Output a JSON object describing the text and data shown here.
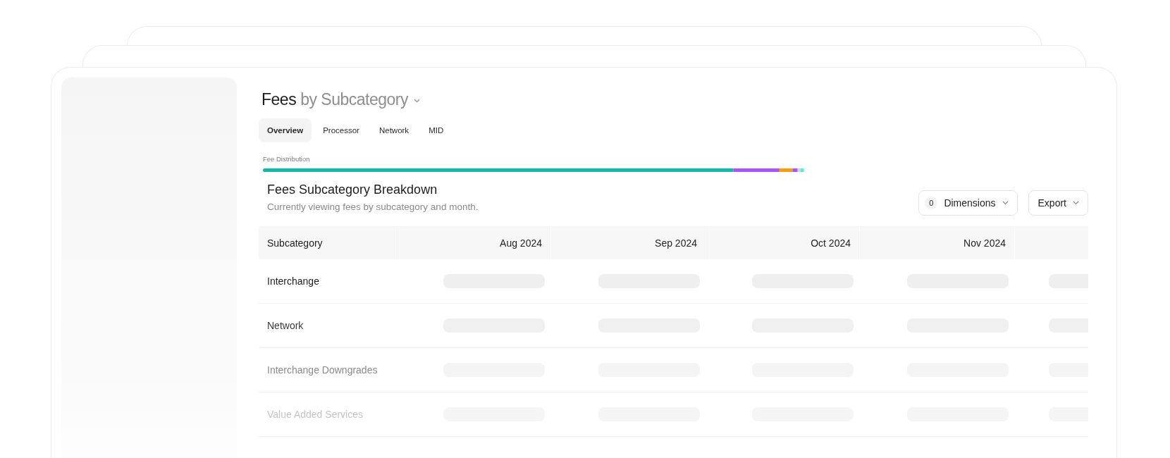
{
  "header": {
    "title": "Fees",
    "title_suffix": "by Subcategory"
  },
  "tabs": [
    {
      "label": "Overview",
      "selected": true
    },
    {
      "label": "Processor",
      "selected": false
    },
    {
      "label": "Network",
      "selected": false
    },
    {
      "label": "MID",
      "selected": false
    }
  ],
  "distribution": {
    "label": "Fee Distribution"
  },
  "section": {
    "title": "Fees Subcategory Breakdown",
    "subtitle": "Currently viewing fees by subcategory and month."
  },
  "buttons": {
    "dimensions_count": "0",
    "dimensions": "Dimensions",
    "export": "Export"
  },
  "table": {
    "columns": [
      "Subcategory",
      "Aug 2024",
      "Sep 2024",
      "Oct 2024",
      "Nov 2024"
    ],
    "rows": [
      {
        "name": "Interchange"
      },
      {
        "name": "Network"
      },
      {
        "name": "Interchange Downgrades"
      },
      {
        "name": "Value Added Services"
      }
    ]
  }
}
